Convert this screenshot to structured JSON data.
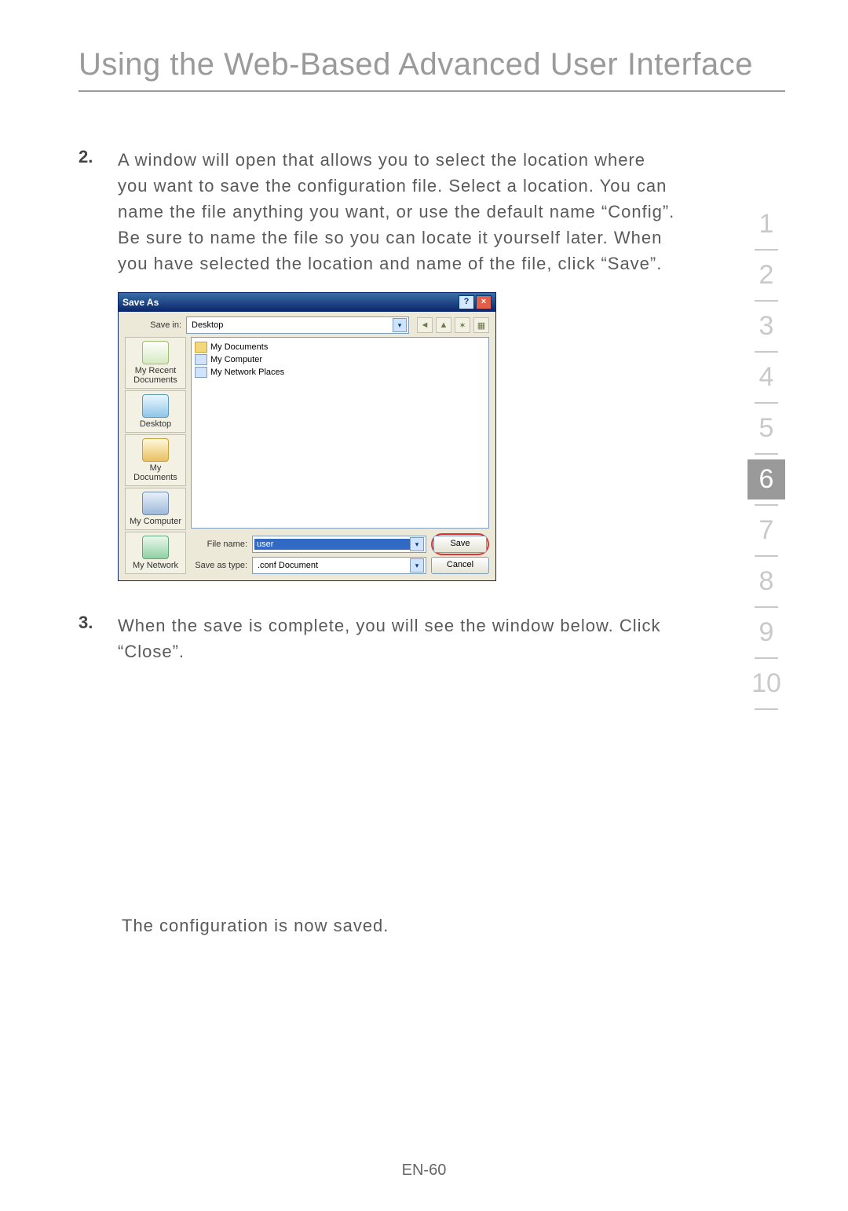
{
  "page_title": "Using the Web-Based Advanced User Interface",
  "section_label": "section",
  "nav": [
    "1",
    "2",
    "3",
    "4",
    "5",
    "6",
    "7",
    "8",
    "9",
    "10"
  ],
  "nav_active_index": 5,
  "steps": {
    "s2_num": "2.",
    "s2_text": "A window will open that allows you to select the location where you want to save the configuration file. Select a location. You can name the file anything you want, or use the default name “Config”. Be sure to name the file so you can locate it yourself later. When you have selected the location and name of the file, click “Save”.",
    "s3_num": "3.",
    "s3_text": "When the save is complete, you will see the window below. Click “Close”."
  },
  "dialog": {
    "title": "Save As",
    "help_btn": "?",
    "close_btn": "×",
    "save_in_label": "Save in:",
    "save_in_value": "Desktop",
    "places": {
      "recent": "My Recent Documents",
      "desktop": "Desktop",
      "docs": "My Documents",
      "computer": "My Computer",
      "network": "My Network"
    },
    "file_list": {
      "i0": "My Documents",
      "i1": "My Computer",
      "i2": "My Network Places"
    },
    "file_name_label": "File name:",
    "file_name_value": "user",
    "save_type_label": "Save as type:",
    "save_type_value": ".conf Document",
    "save_btn": "Save",
    "cancel_btn": "Cancel"
  },
  "final_text": "The configuration is now saved.",
  "footer": "EN-60"
}
